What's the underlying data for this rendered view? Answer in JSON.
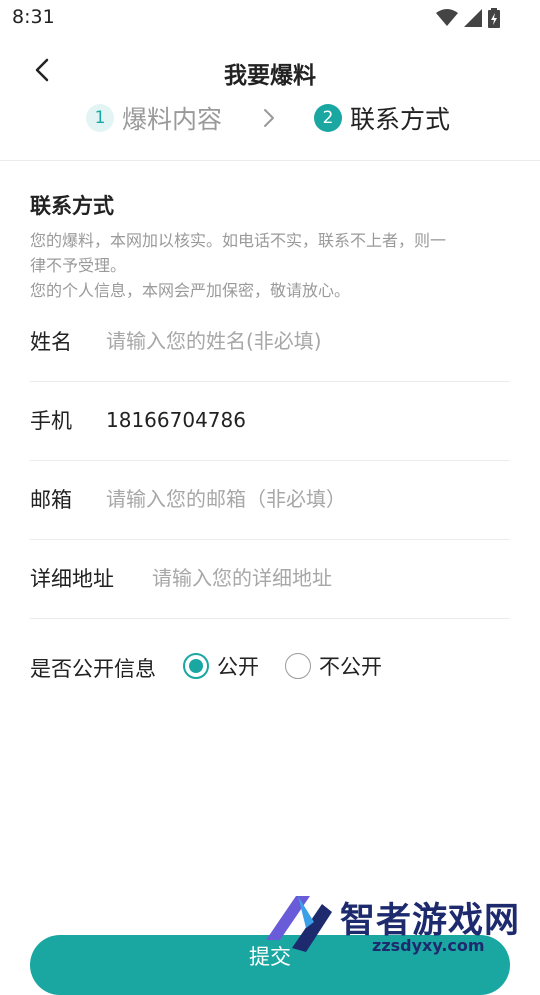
{
  "status_bar": {
    "time": "8:31"
  },
  "header": {
    "title": "我要爆料"
  },
  "steps": [
    {
      "number": "1",
      "label": "爆料内容",
      "active": false
    },
    {
      "number": "2",
      "label": "联系方式",
      "active": true
    }
  ],
  "section": {
    "title": "联系方式",
    "notice_lines": [
      "您的爆料，本网加以核实。如电话不实，联系不上者，则一",
      "律不予受理。",
      "您的个人信息，本网会严加保密，敬请放心。"
    ]
  },
  "form": {
    "name": {
      "label": "姓名",
      "value": "",
      "placeholder": "请输入您的姓名(非必填)"
    },
    "phone": {
      "label": "手机",
      "value": "18166704786",
      "placeholder": ""
    },
    "email": {
      "label": "邮箱",
      "value": "",
      "placeholder": "请输入您的邮箱（非必填）"
    },
    "address": {
      "label": "详细地址",
      "value": "",
      "placeholder": "请输入您的详细地址"
    },
    "public": {
      "label": "是否公开信息",
      "options": [
        "公开",
        "不公开"
      ],
      "selected": "公开"
    }
  },
  "submit": {
    "label": "提交"
  },
  "watermark": {
    "name": "智者游戏网",
    "url": "zzsdyxy.com"
  },
  "colors": {
    "accent": "#1aa7a2",
    "accent_light": "#e3f4f4",
    "hint": "#9a9a9a",
    "divider": "#ececec"
  },
  "icons": [
    "wifi-icon",
    "cell-signal-icon",
    "battery-icon",
    "back-arrow-icon",
    "chevron-right-icon"
  ]
}
